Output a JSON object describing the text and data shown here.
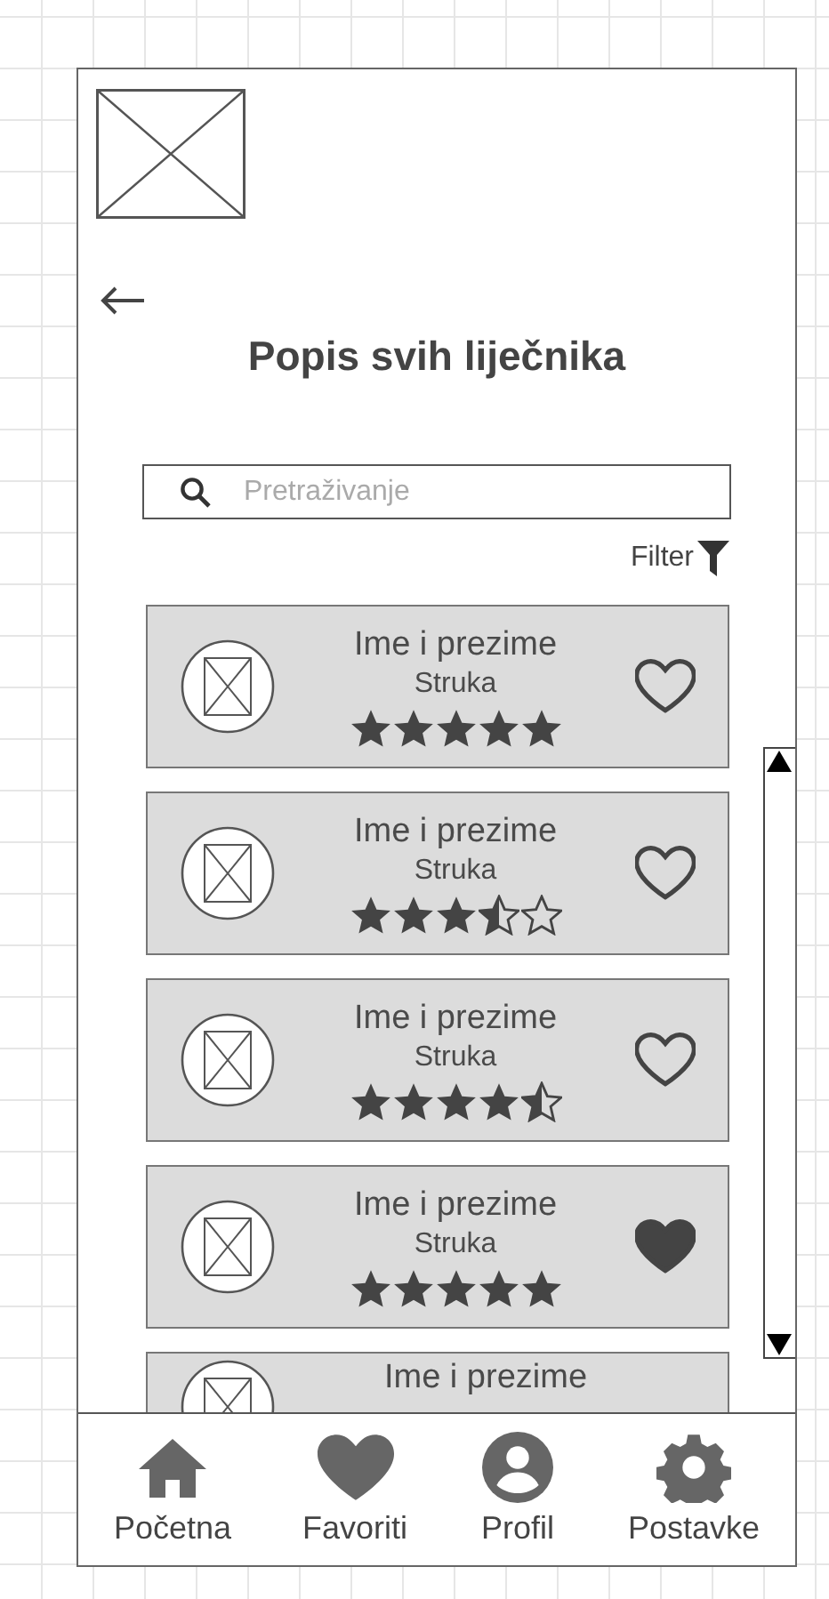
{
  "title": "Popis svih liječnika",
  "search": {
    "placeholder": "Pretraživanje"
  },
  "filter": {
    "label": "Filter"
  },
  "doctors": [
    {
      "name": "Ime i prezime",
      "specialty": "Struka",
      "stars": 5,
      "favorite": false
    },
    {
      "name": "Ime i prezime",
      "specialty": "Struka",
      "stars": 3.5,
      "favorite": false
    },
    {
      "name": "Ime i prezime",
      "specialty": "Struka",
      "stars": 4.5,
      "favorite": false
    },
    {
      "name": "Ime i prezime",
      "specialty": "Struka",
      "stars": 5,
      "favorite": true
    },
    {
      "name": "Ime i prezime"
    }
  ],
  "nav": [
    {
      "kind": "home",
      "label": "Početna"
    },
    {
      "kind": "heart",
      "label": "Favoriti"
    },
    {
      "kind": "user",
      "label": "Profil"
    },
    {
      "kind": "gear",
      "label": "Postavke"
    }
  ]
}
